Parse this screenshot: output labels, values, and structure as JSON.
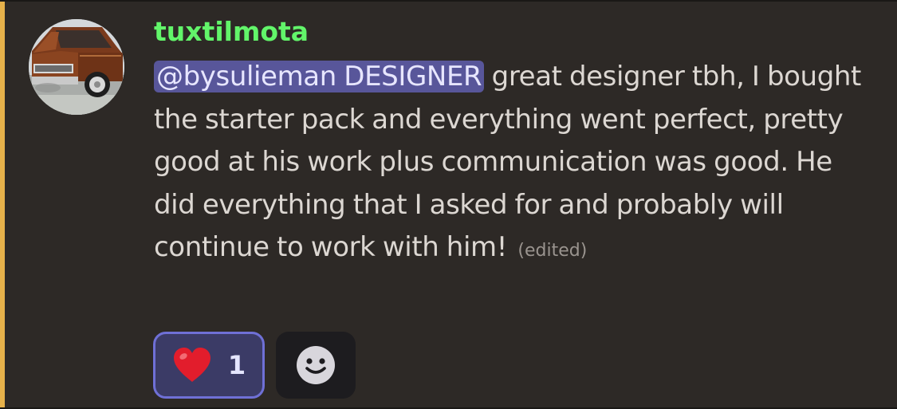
{
  "colors": {
    "highlight_bar": "#e6b14a",
    "username": "#62f56a",
    "mention_bg": "#58569a",
    "reaction_border": "#6f70d6"
  },
  "message": {
    "author": "tuxtilmota",
    "mention": "@bysulieman DESIGNER",
    "text": " great designer tbh, I bought the starter pack and everything went perfect, pretty good at his work plus communication was good. He did everything that I asked for and probably will continue to work with him!",
    "edited_label": "(edited)",
    "avatar_icon": "avatar-classic-truck-icon"
  },
  "reactions": [
    {
      "emoji_icon": "heart-emoji-icon",
      "count": "1",
      "selected": true
    }
  ],
  "add_reaction": {
    "icon": "smiley-add-reaction-icon"
  }
}
